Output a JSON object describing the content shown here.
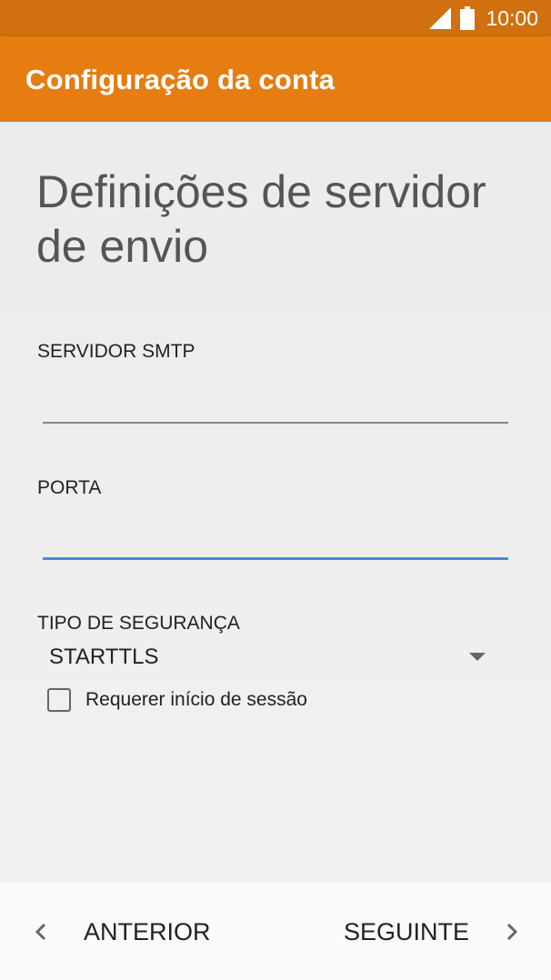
{
  "status_bar": {
    "time": "10:00",
    "signal_icon": "signal-icon",
    "battery_icon": "battery-icon"
  },
  "app_bar": {
    "title": "Configuração da conta"
  },
  "page": {
    "heading": "Definições de servidor de envio"
  },
  "smtp": {
    "label": "SERVIDOR SMTP",
    "value": ""
  },
  "port": {
    "label": "PORTA",
    "value": ""
  },
  "security": {
    "label": "TIPO DE SEGURANÇA",
    "selected": "STARTTLS",
    "arrow_icon": "dropdown-arrow-icon"
  },
  "login_required": {
    "label": "Requerer início de sessão",
    "checked": false
  },
  "nav": {
    "previous_label": "ANTERIOR",
    "next_label": "SEGUINTE",
    "previous_icon": "chevron-left-icon",
    "next_icon": "chevron-right-icon"
  },
  "colors": {
    "status_bar": "#d0700f",
    "app_bar": "#e57d10",
    "focus_underline": "#4d87dd"
  }
}
